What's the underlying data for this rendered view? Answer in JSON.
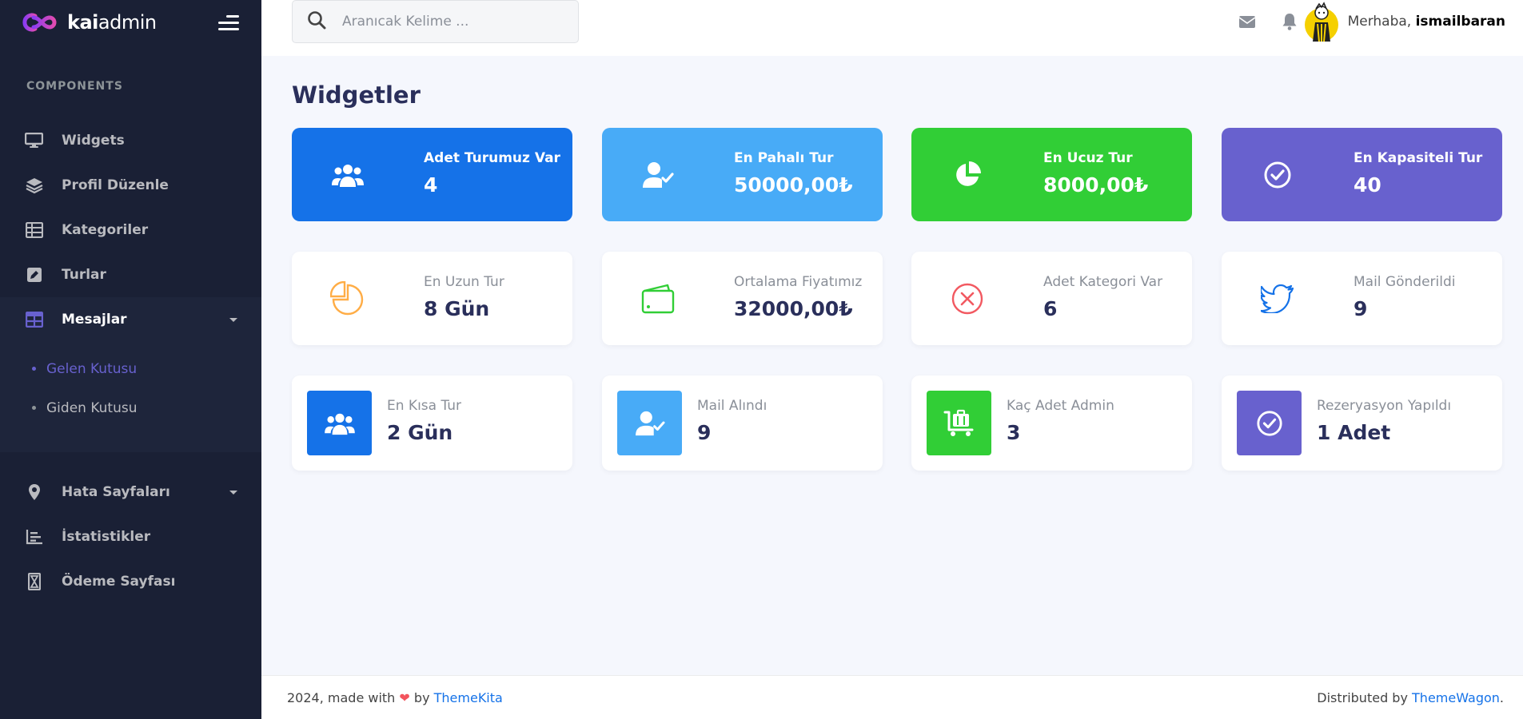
{
  "brand": {
    "bold": "kai",
    "light": "admin"
  },
  "sidebar": {
    "section_title": "COMPONENTS",
    "items": [
      {
        "label": "Widgets",
        "icon": "desktop-icon"
      },
      {
        "label": "Profil Düzenle",
        "icon": "layers-icon"
      },
      {
        "label": "Kategoriler",
        "icon": "table-icon"
      },
      {
        "label": "Turlar",
        "icon": "pen-square-icon"
      },
      {
        "label": "Mesajlar",
        "icon": "grid-icon"
      }
    ],
    "submenu": [
      {
        "label": "Gelen Kutusu"
      },
      {
        "label": "Giden Kutusu"
      }
    ],
    "items2": [
      {
        "label": "Hata Sayfaları",
        "icon": "map-pin-icon"
      },
      {
        "label": "İstatistikler",
        "icon": "bar-chart-icon"
      },
      {
        "label": "Ödeme Sayfası",
        "icon": "hourglass-icon"
      }
    ]
  },
  "header": {
    "search_placeholder": "Aranıcak Kelime ...",
    "greeting": "Merhaba,",
    "username": "ismailbaran"
  },
  "page_title": "Widgetler",
  "colors": {
    "primary": "#1572e8",
    "info": "#48abf7",
    "success": "#31ce36",
    "secondary": "#6861ce",
    "warning": "#ffad46",
    "danger": "#f25961"
  },
  "row1": [
    {
      "label": "Adet Turumuz Var",
      "value": "4",
      "icon": "users-icon"
    },
    {
      "label": "En Pahalı Tur",
      "value": "50000,00₺",
      "icon": "user-check-icon"
    },
    {
      "label": "En Ucuz Tur",
      "value": "8000,00₺",
      "icon": "pie-chart-icon"
    },
    {
      "label": "En Kapasiteli Tur",
      "value": "40",
      "icon": "check-circle-icon"
    }
  ],
  "row2": [
    {
      "label": "En Uzun Tur",
      "value": "8 Gün",
      "icon": "pie-outline-icon"
    },
    {
      "label": "Ortalama Fiyatımız",
      "value": "32000,00₺",
      "icon": "wallet-icon"
    },
    {
      "label": "Adet Kategori Var",
      "value": "6",
      "icon": "close-circle-icon"
    },
    {
      "label": "Mail Gönderildi",
      "value": "9",
      "icon": "twitter-icon"
    }
  ],
  "row3": [
    {
      "label": "En Kısa Tur",
      "value": "2 Gün",
      "icon": "users-icon"
    },
    {
      "label": "Mail Alındı",
      "value": "9",
      "icon": "user-check-icon"
    },
    {
      "label": "Kaç Adet Admin",
      "value": "3",
      "icon": "luggage-cart-icon"
    },
    {
      "label": "Rezeryasyon Yapıldı",
      "value": "1 Adet",
      "icon": "check-circle-icon"
    }
  ],
  "footer": {
    "left_prefix": "2024, made with",
    "left_by": "by",
    "left_link": "ThemeKita",
    "right_prefix": "Distributed by",
    "right_link": "ThemeWagon",
    "right_suffix": "."
  }
}
